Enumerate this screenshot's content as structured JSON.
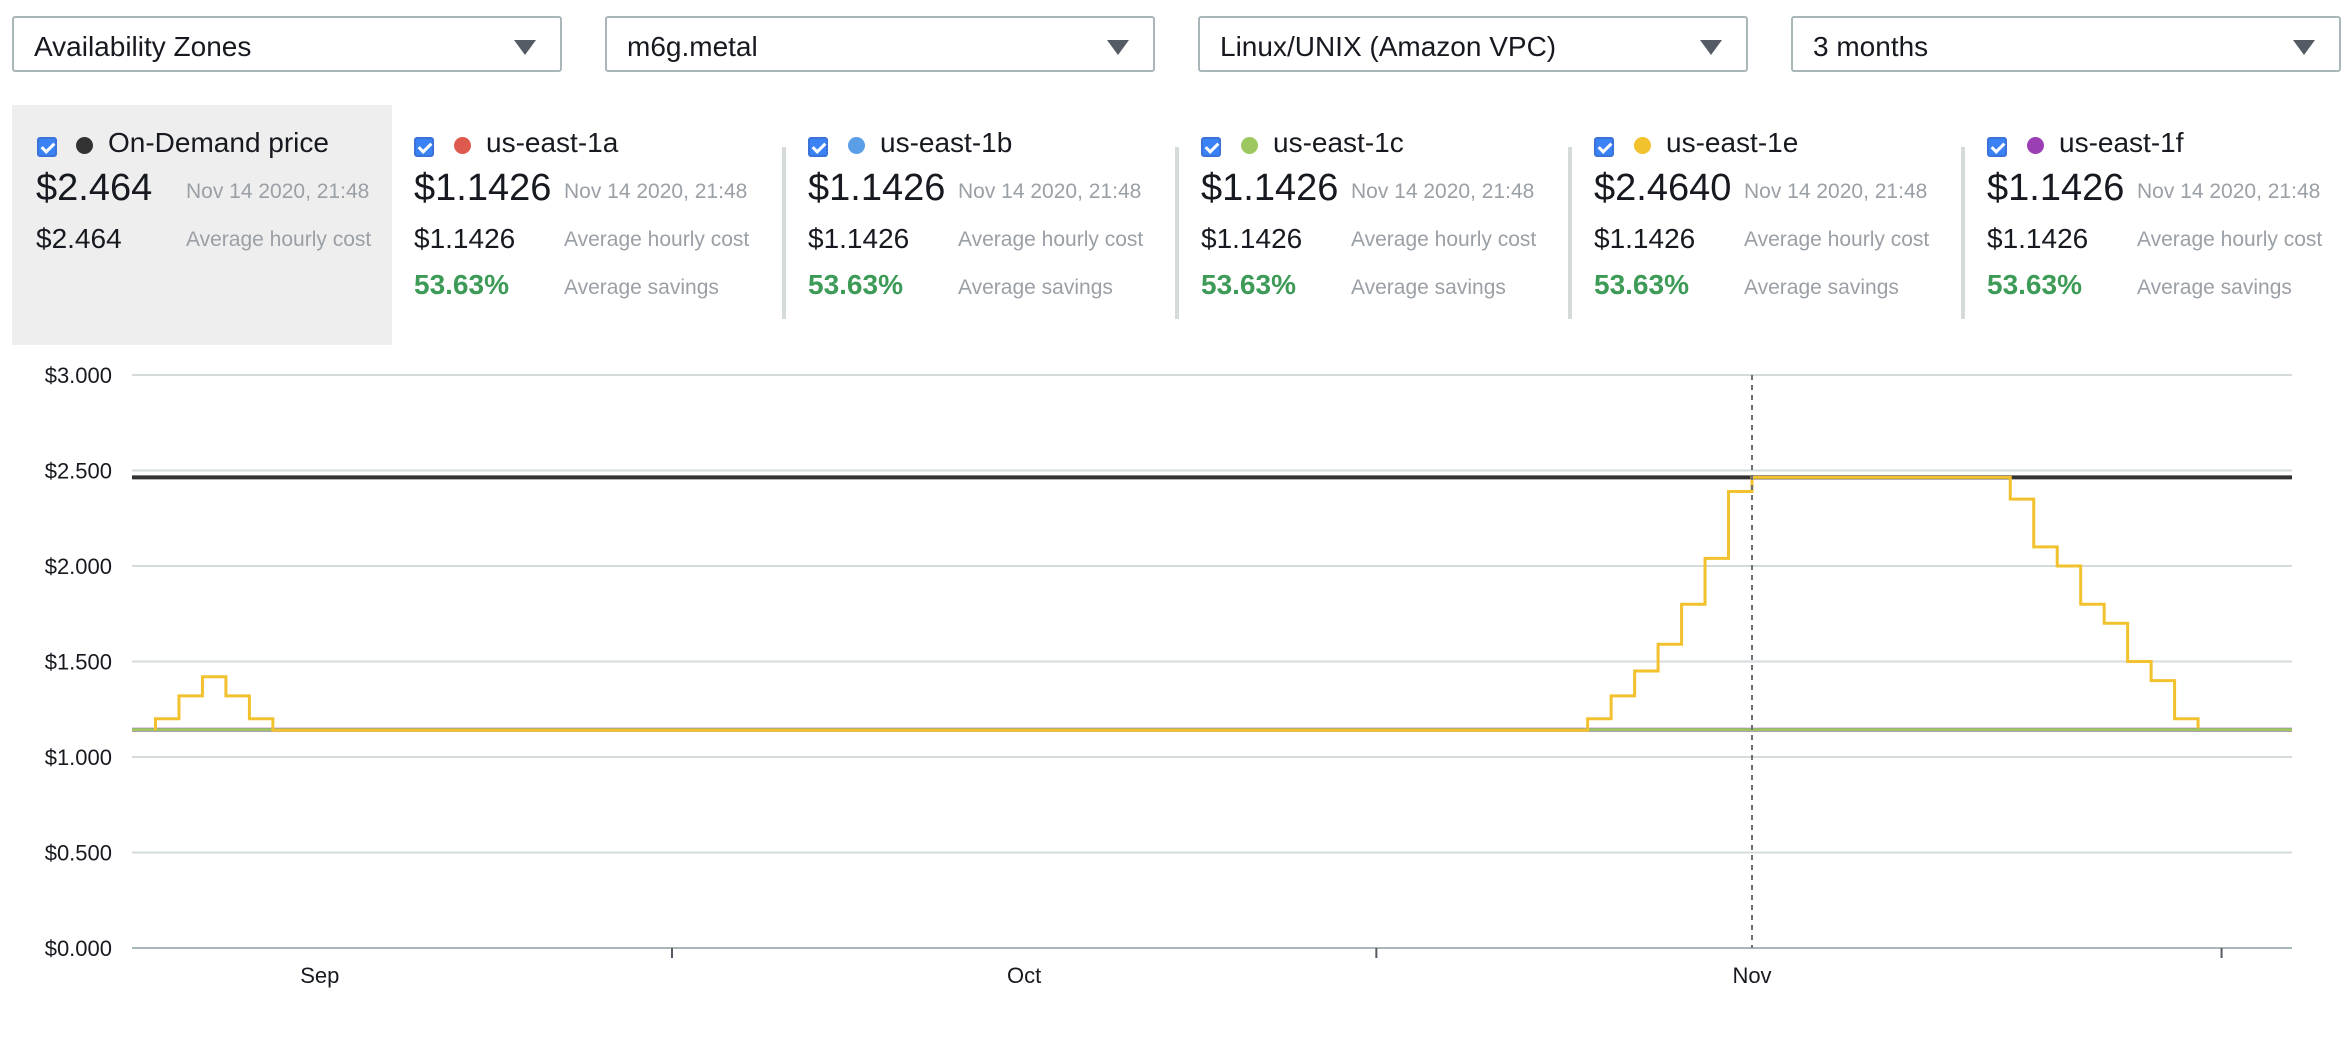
{
  "filters": [
    {
      "value": "Availability Zones"
    },
    {
      "value": "m6g.metal"
    },
    {
      "value": "Linux/UNIX (Amazon VPC)"
    },
    {
      "value": "3 months"
    }
  ],
  "legend": {
    "on_demand": {
      "name": "On-Demand price",
      "price": "$2.464",
      "timestamp": "Nov 14 2020, 21:48",
      "avg": "$2.464",
      "avg_label": "Average hourly cost",
      "color": "#333333"
    },
    "zones": [
      {
        "name": "us-east-1a",
        "price": "$1.1426",
        "timestamp": "Nov 14 2020, 21:48",
        "avg": "$1.1426",
        "avg_label": "Average hourly cost",
        "savings": "53.63%",
        "savings_label": "Average savings",
        "color": "#de5a4f"
      },
      {
        "name": "us-east-1b",
        "price": "$1.1426",
        "timestamp": "Nov 14 2020, 21:48",
        "avg": "$1.1426",
        "avg_label": "Average hourly cost",
        "savings": "53.63%",
        "savings_label": "Average savings",
        "color": "#5b9ee8"
      },
      {
        "name": "us-east-1c",
        "price": "$1.1426",
        "timestamp": "Nov 14 2020, 21:48",
        "avg": "$1.1426",
        "avg_label": "Average hourly cost",
        "savings": "53.63%",
        "savings_label": "Average savings",
        "color": "#9dc85f"
      },
      {
        "name": "us-east-1e",
        "price": "$2.4640",
        "timestamp": "Nov 14 2020, 21:48",
        "avg": "$1.1426",
        "avg_label": "Average hourly cost",
        "savings": "53.63%",
        "savings_label": "Average savings",
        "color": "#f2c12e"
      },
      {
        "name": "us-east-1f",
        "price": "$1.1426",
        "timestamp": "Nov 14 2020, 21:48",
        "avg": "$1.1426",
        "avg_label": "Average hourly cost",
        "savings": "53.63%",
        "savings_label": "Average savings",
        "color": "#9b3fb5"
      }
    ]
  },
  "chart_data": {
    "type": "line",
    "x_unit": "date",
    "xlim": [
      "2020-08-16",
      "2020-11-16"
    ],
    "ylim": [
      0,
      3
    ],
    "yticks": [
      0,
      0.5,
      1,
      1.5,
      2,
      2.5,
      3
    ],
    "ytick_labels": [
      "$0.000",
      "$0.500",
      "$1.000",
      "$1.500",
      "$2.000",
      "$2.500",
      "$3.000"
    ],
    "xtick_labels": [
      {
        "label": "Sep",
        "date": "2020-08-24"
      },
      {
        "label": "Oct",
        "date": "2020-09-23"
      },
      {
        "label": "Nov",
        "date": "2020-10-24"
      }
    ],
    "xtick_marks": [
      "2020-09-08",
      "2020-10-08",
      "2020-11-13"
    ],
    "grid": true,
    "cursor_date": "2020-10-24",
    "series": [
      {
        "name": "On-Demand price",
        "color": "#333333",
        "step": true,
        "points": [
          [
            "2020-08-16",
            2.464
          ],
          [
            "2020-11-16",
            2.464
          ]
        ]
      },
      {
        "name": "us-east-1a",
        "color": "#de5a4f",
        "step": true,
        "points": [
          [
            "2020-08-16",
            1.1426
          ],
          [
            "2020-11-16",
            1.1426
          ]
        ]
      },
      {
        "name": "us-east-1b",
        "color": "#5b9ee8",
        "step": true,
        "points": [
          [
            "2020-08-16",
            1.1426
          ],
          [
            "2020-11-16",
            1.1426
          ]
        ]
      },
      {
        "name": "us-east-1c",
        "color": "#9dc85f",
        "step": true,
        "points": [
          [
            "2020-08-16",
            1.1426
          ],
          [
            "2020-11-16",
            1.1426
          ]
        ]
      },
      {
        "name": "us-east-1e",
        "color": "#f2c12e",
        "step": true,
        "points": [
          [
            "2020-08-17",
            1.14
          ],
          [
            "2020-08-17",
            1.2
          ],
          [
            "2020-08-18",
            1.26
          ],
          [
            "2020-08-18",
            1.32
          ],
          [
            "2020-08-19",
            1.37
          ],
          [
            "2020-08-19",
            1.42
          ],
          [
            "2020-08-20",
            1.37
          ],
          [
            "2020-08-20",
            1.32
          ],
          [
            "2020-08-21",
            1.26
          ],
          [
            "2020-08-21",
            1.2
          ],
          [
            "2020-08-22",
            1.14
          ],
          [
            "2020-10-17",
            1.14
          ],
          [
            "2020-10-17",
            1.2
          ],
          [
            "2020-10-18",
            1.26
          ],
          [
            "2020-10-18",
            1.32
          ],
          [
            "2020-10-19",
            1.38
          ],
          [
            "2020-10-19",
            1.45
          ],
          [
            "2020-10-20",
            1.52
          ],
          [
            "2020-10-20",
            1.59
          ],
          [
            "2020-10-21",
            1.66
          ],
          [
            "2020-10-21",
            1.73
          ],
          [
            "2020-10-21",
            1.8
          ],
          [
            "2020-10-22",
            1.88
          ],
          [
            "2020-10-22",
            1.96
          ],
          [
            "2020-10-22",
            2.04
          ],
          [
            "2020-10-23",
            2.13
          ],
          [
            "2020-10-23",
            2.22
          ],
          [
            "2020-10-23",
            2.31
          ],
          [
            "2020-10-23",
            2.39
          ],
          [
            "2020-10-24",
            2.464
          ],
          [
            "2020-11-04",
            2.464
          ],
          [
            "2020-11-04",
            2.35
          ],
          [
            "2020-11-05",
            2.22
          ],
          [
            "2020-11-05",
            2.1
          ],
          [
            "2020-11-06",
            2.0
          ],
          [
            "2020-11-07",
            1.9
          ],
          [
            "2020-11-07",
            1.8
          ],
          [
            "2020-11-08",
            1.7
          ],
          [
            "2020-11-09",
            1.6
          ],
          [
            "2020-11-09",
            1.5
          ],
          [
            "2020-11-10",
            1.4
          ],
          [
            "2020-11-11",
            1.3
          ],
          [
            "2020-11-11",
            1.2
          ],
          [
            "2020-11-12",
            1.15
          ]
        ]
      },
      {
        "name": "us-east-1f",
        "color": "#9b3fb5",
        "step": true,
        "points": [
          [
            "2020-08-16",
            1.1426
          ],
          [
            "2020-11-16",
            1.1426
          ]
        ]
      }
    ]
  }
}
